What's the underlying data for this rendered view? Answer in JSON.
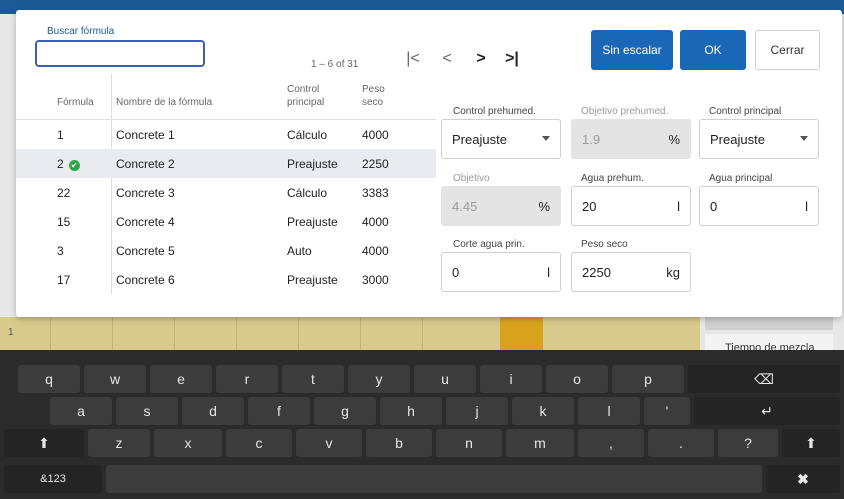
{
  "search": {
    "label": "Buscar fórmula",
    "value": ""
  },
  "pager": {
    "text": "1 – 6 of 31",
    "first": "|<",
    "prev": "<",
    "next": ">",
    "last": ">|"
  },
  "buttons": {
    "sin_escalar": "Sin escalar",
    "ok": "OK",
    "cerrar": "Cerrar"
  },
  "table": {
    "headers": {
      "formula": "Fórmula",
      "name": "Nombre de la fórmula",
      "control_line1": "Control",
      "control_line2": "principal",
      "peso_line1": "Peso",
      "peso_line2": "seco"
    },
    "rows": [
      {
        "formula": "1",
        "name": "Concrete 1",
        "control": "Cálculo",
        "peso": "4000"
      },
      {
        "formula": "2",
        "name": "Concrete 2",
        "control": "Preajuste",
        "peso": "2250"
      },
      {
        "formula": "22",
        "name": "Concrete 3",
        "control": "Cálculo",
        "peso": "3383"
      },
      {
        "formula": "15",
        "name": "Concrete 4",
        "control": "Preajuste",
        "peso": "4000"
      },
      {
        "formula": "3",
        "name": "Concrete 5",
        "control": "Auto",
        "peso": "4000"
      },
      {
        "formula": "17",
        "name": "Concrete 6",
        "control": "Preajuste",
        "peso": "3000"
      }
    ]
  },
  "fields": {
    "control_prehumed": {
      "label": "Control prehumed.",
      "value": "Preajuste"
    },
    "objetivo_prehumed": {
      "label": "Objetivo prehumed.",
      "value": "1.9",
      "unit": "%"
    },
    "control_principal": {
      "label": "Control principal",
      "value": "Preajuste"
    },
    "objetivo": {
      "label": "Objetivo",
      "value": "4.45",
      "unit": "%"
    },
    "agua_prehum": {
      "label": "Agua prehum.",
      "value": "20",
      "unit": "l"
    },
    "agua_principal": {
      "label": "Agua principal",
      "value": "0",
      "unit": "l"
    },
    "corte_agua": {
      "label": "Corte agua prin.",
      "value": "0",
      "unit": "l"
    },
    "peso_seco": {
      "label": "Peso seco",
      "value": "2250",
      "unit": "kg"
    }
  },
  "background": {
    "row_number": "1",
    "tiempo_label": "Tiempo de mezcla"
  },
  "keyboard": {
    "row1": [
      "q",
      "w",
      "e",
      "r",
      "t",
      "y",
      "u",
      "i",
      "o",
      "p"
    ],
    "row2": [
      "a",
      "s",
      "d",
      "f",
      "g",
      "h",
      "j",
      "k",
      "l",
      "'"
    ],
    "row3": [
      "z",
      "x",
      "c",
      "v",
      "b",
      "n",
      "m",
      ",",
      ".",
      "?"
    ],
    "backspace": "⌫",
    "enter": "↵",
    "shift": "⬆",
    "mode": "&123",
    "close": "✖"
  },
  "colors": {
    "accent": "#1a67b7",
    "check": "#2fa64a",
    "selected_row": "#e8ebef"
  }
}
